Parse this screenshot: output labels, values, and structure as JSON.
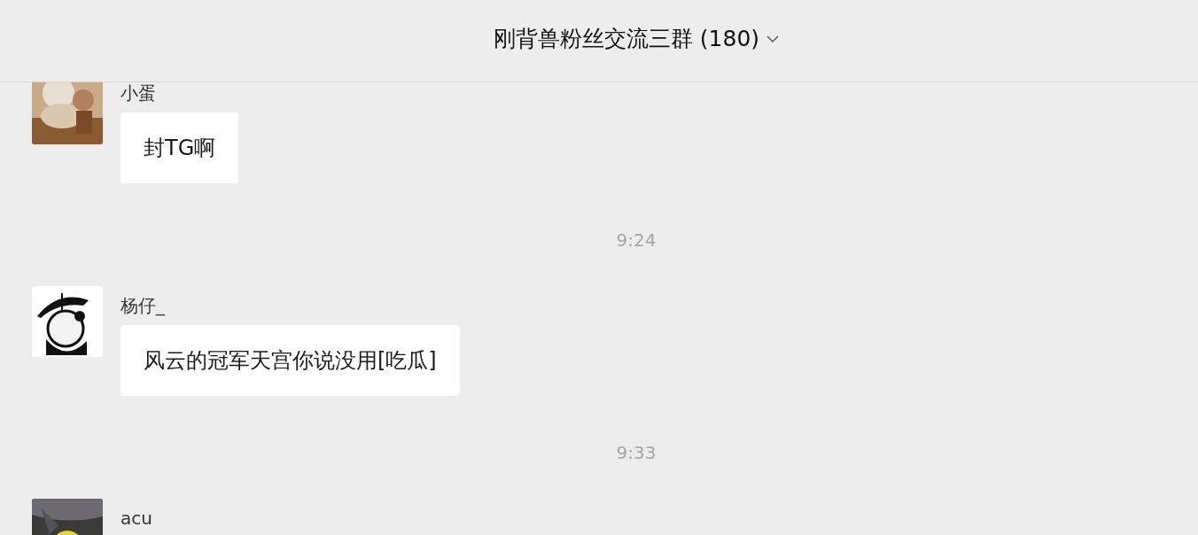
{
  "header": {
    "title": "刚背兽粉丝交流三群 (180)"
  },
  "items": [
    {
      "kind": "message",
      "sender": "小蛋",
      "text": "封TG啊"
    },
    {
      "kind": "time",
      "text": "9:24"
    },
    {
      "kind": "message",
      "sender": "杨仔_",
      "text": "风云的冠军天宫你说没用[吃瓜]"
    },
    {
      "kind": "time",
      "text": "9:33"
    },
    {
      "kind": "message",
      "sender": "acu"
    }
  ]
}
